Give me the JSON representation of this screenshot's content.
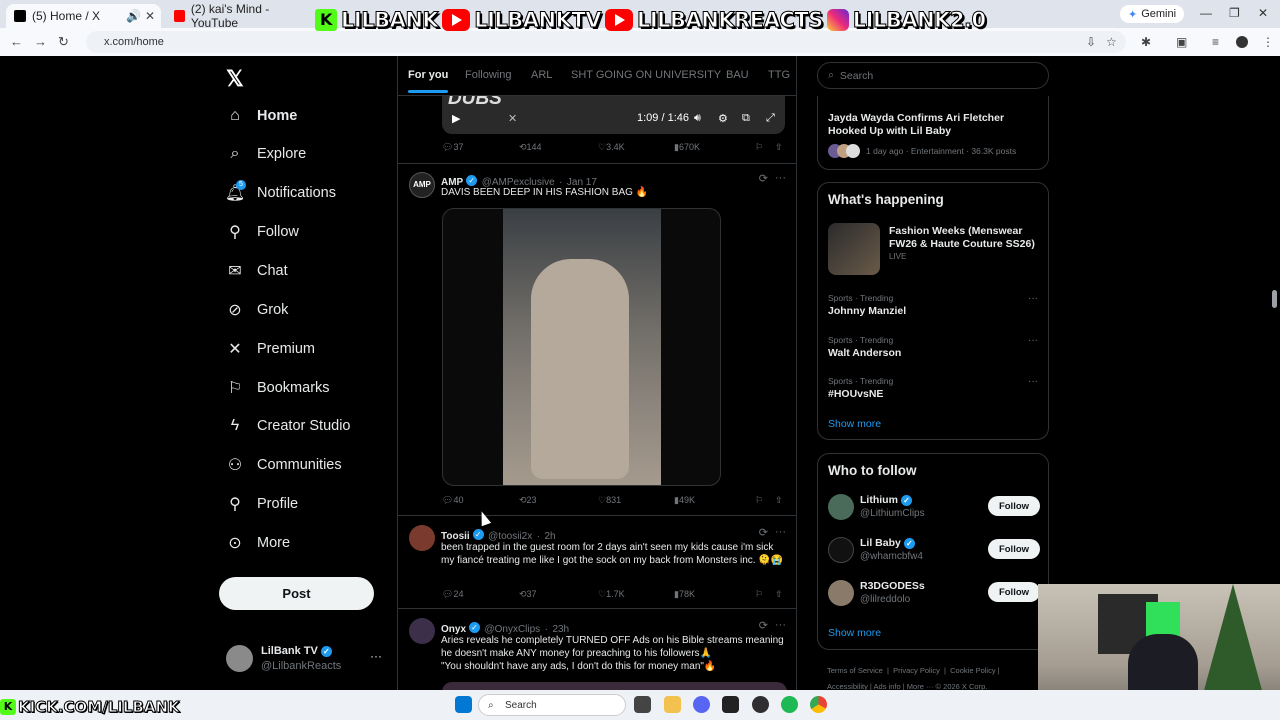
{
  "browser": {
    "tabs": [
      {
        "title": "(5) Home / X",
        "active": true
      },
      {
        "title": "(2) kai's Mind - YouTube",
        "active": false
      }
    ],
    "gemini_label": "Gemini",
    "url": "x.com/home"
  },
  "stream_banner": {
    "items": [
      "LILBANK",
      "LILBANKTV",
      "LILBANKREACTS",
      "LILBANK2.0"
    ],
    "bottom_left": "KICK.COM/LILBANK"
  },
  "left_nav": {
    "items": [
      {
        "label": "Home",
        "icon": "home-icon"
      },
      {
        "label": "Explore",
        "icon": "search-icon"
      },
      {
        "label": "Notifications",
        "icon": "bell-icon"
      },
      {
        "label": "Follow",
        "icon": "person-add-icon"
      },
      {
        "label": "Chat",
        "icon": "mail-icon"
      },
      {
        "label": "Grok",
        "icon": "grok-icon"
      },
      {
        "label": "Premium",
        "icon": "x-icon"
      },
      {
        "label": "Bookmarks",
        "icon": "bookmark-icon"
      },
      {
        "label": "Creator Studio",
        "icon": "lightning-icon"
      },
      {
        "label": "Communities",
        "icon": "people-icon"
      },
      {
        "label": "Profile",
        "icon": "person-icon"
      },
      {
        "label": "More",
        "icon": "more-circle-icon"
      }
    ],
    "notification_badge": "5",
    "post_button": "Post",
    "account": {
      "name": "LilBank TV",
      "handle": "@LilbankReacts"
    }
  },
  "feed": {
    "tabs": [
      "For you",
      "Following",
      "ARL",
      "SHT GOING ON UNIVERSITY",
      "BAU",
      "TTG"
    ],
    "video_top": {
      "title": "DUBS",
      "time": "1:09 / 1:46"
    },
    "top_actions": {
      "replies": "37",
      "reposts": "144",
      "likes": "3.4K",
      "views": "670K"
    },
    "tweets": [
      {
        "name": "AMP",
        "handle": "@AMPexclusive",
        "time": "Jan 17",
        "text": "DAVIS BEEN DEEP IN HIS FASHION BAG 🔥",
        "replies": "40",
        "reposts": "23",
        "likes": "831",
        "views": "49K"
      },
      {
        "name": "Toosii",
        "handle": "@toosii2x",
        "time": "2h",
        "text": "been trapped in the guest room for 2 days ain't seen my kids cause i'm sick my fiancé treating me like I got the sock on my back from Monsters inc. 🫠😭",
        "replies": "24",
        "reposts": "37",
        "likes": "1.7K",
        "views": "78K"
      },
      {
        "name": "Onyx",
        "handle": "@OnyxClips",
        "time": "23h",
        "text_lines": [
          "Aries reveals he completely TURNED OFF Ads on his Bible streams meaning he doesn't make ANY money for preaching to his followers🙏",
          "\"You shouldn't have any ads, I don't do this for money man\"🔥"
        ]
      }
    ]
  },
  "right": {
    "search_placeholder": "Search",
    "top_story": {
      "title": "Jayda Wayda Confirms Ari Fletcher Hooked Up with Lil Baby",
      "meta": "1 day ago · Entertainment · 36.3K posts"
    },
    "whats_happening": {
      "title": "What's happening",
      "feature": {
        "title": "Fashion Weeks (Menswear FW26 & Haute Couture SS26)",
        "status": "LIVE"
      },
      "trends": [
        {
          "category": "Sports · Trending",
          "topic": "Johnny Manziel"
        },
        {
          "category": "Sports · Trending",
          "topic": "Walt Anderson"
        },
        {
          "category": "Sports · Trending",
          "topic": "#HOUvsNE"
        }
      ],
      "show_more": "Show more"
    },
    "who_to_follow": {
      "title": "Who to follow",
      "accounts": [
        {
          "name": "Lithium",
          "handle": "@LithiumClips",
          "button": "Follow"
        },
        {
          "name": "Lil Baby",
          "handle": "@whamcbfw4",
          "button": "Follow"
        },
        {
          "name": "R3DGODESs",
          "handle": "@lilreddolo",
          "button": "Follow"
        }
      ],
      "show_more": "Show more"
    },
    "footer": [
      "Terms of Service",
      "Privacy Policy",
      "Cookie Policy",
      "Accessibility",
      "Ads info",
      "More ···",
      "© 2026 X Corp."
    ]
  },
  "taskbar": {
    "search": "Search"
  },
  "colors": {
    "accent": "#1d9bf0",
    "bg": "#000000",
    "border": "#2f3336",
    "muted": "#71767b"
  }
}
